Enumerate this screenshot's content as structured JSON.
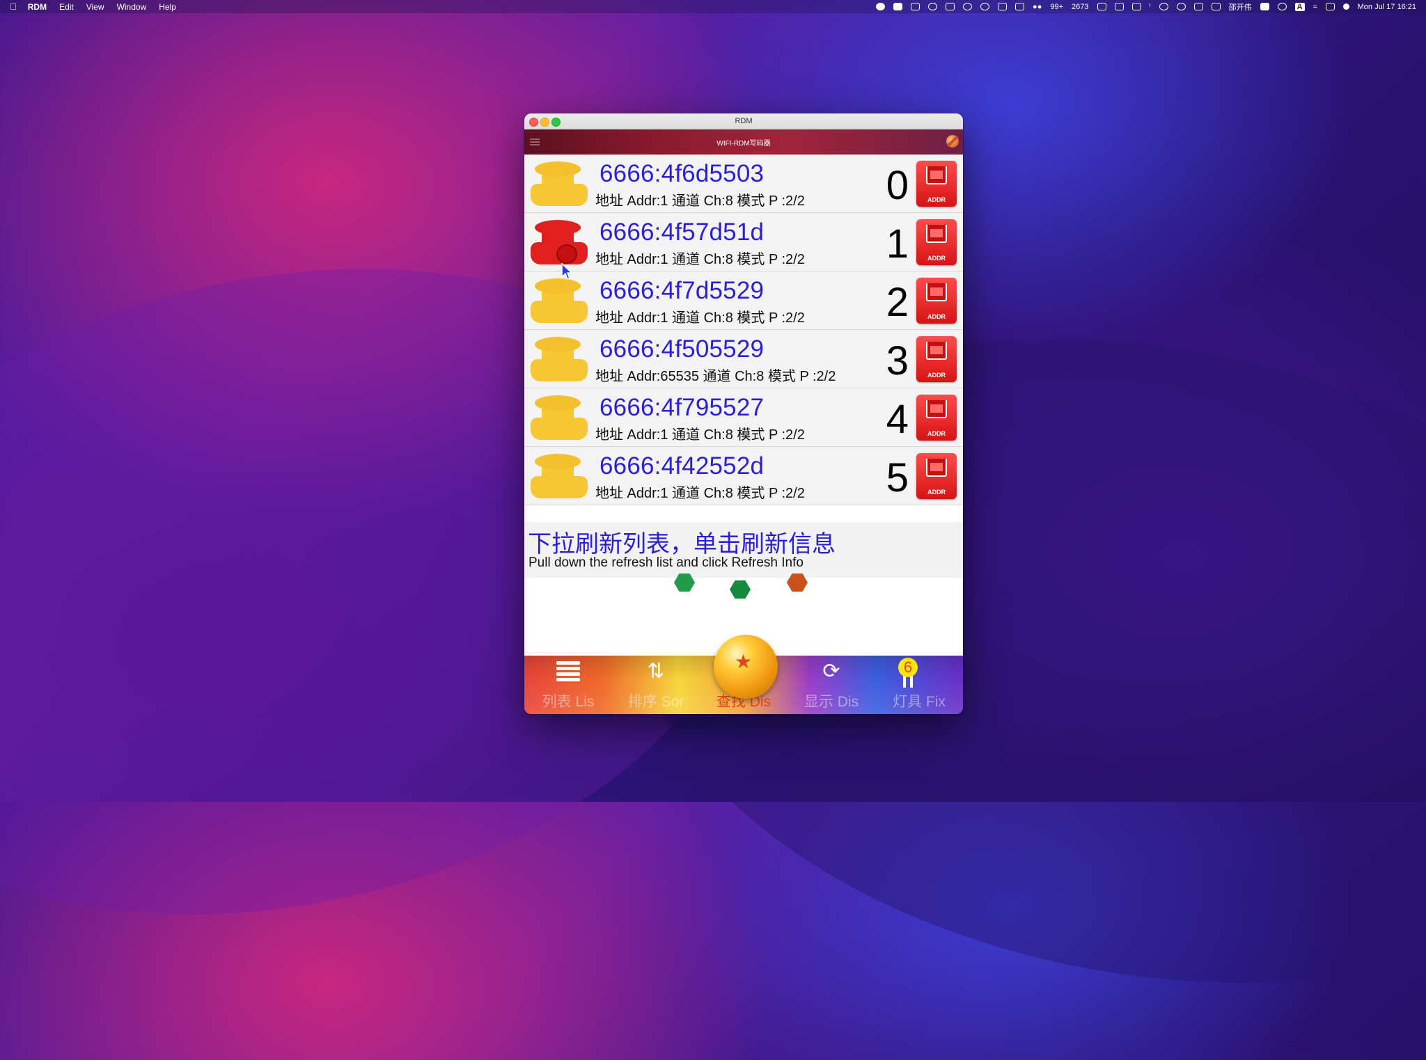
{
  "menubar": {
    "app": "RDM",
    "menus": [
      "Edit",
      "View",
      "Window",
      "Help"
    ],
    "status": {
      "wechat_count": "99+",
      "counter": "2673",
      "user": "邵开伟",
      "input_method": "A",
      "datetime": "Mon Jul 17  16:21"
    }
  },
  "window": {
    "title": "RDM",
    "app_title": "WIFI-RDM写码器"
  },
  "devices": [
    {
      "id": "6666:4f6d5503",
      "info": "地址 Addr:1  通道 Ch:8  模式 P :2/2",
      "index": "0",
      "state": "normal"
    },
    {
      "id": "6666:4f57d51d",
      "info": "地址 Addr:1  通道 Ch:8  模式 P :2/2",
      "index": "1",
      "state": "selected"
    },
    {
      "id": "6666:4f7d5529",
      "info": "地址 Addr:1  通道 Ch:8  模式 P :2/2",
      "index": "2",
      "state": "normal"
    },
    {
      "id": "6666:4f505529",
      "info": "地址 Addr:65535  通道 Ch:8  模式 P :2/2",
      "index": "3",
      "state": "normal"
    },
    {
      "id": "6666:4f795527",
      "info": "地址 Addr:1  通道 Ch:8  模式 P :2/2",
      "index": "4",
      "state": "normal"
    },
    {
      "id": "6666:4f42552d",
      "info": "地址 Addr:1  通道 Ch:8  模式 P :2/2",
      "index": "5",
      "state": "normal"
    }
  ],
  "addr_button_label": "ADDR",
  "hint": {
    "zh": "下拉刷新列表，单击刷新信息",
    "en": "Pull down the refresh list and click Refresh Info"
  },
  "tabs": [
    {
      "label": "列表 Lis",
      "icon": "list-icon"
    },
    {
      "label": "排序 Sor",
      "icon": "sort-icon"
    },
    {
      "label": "查找 Dis",
      "icon": "star-ball-icon",
      "active": true
    },
    {
      "label": "显示 Dis",
      "icon": "refresh-icon"
    },
    {
      "label": "灯具 Fix",
      "icon": "fixture-icon",
      "badge": "6"
    }
  ],
  "colors": {
    "accent_blue": "#2a1fd6",
    "spool_yellow": "#f6c633",
    "spool_red": "#e21f1f",
    "active_tab": "#e2441c"
  }
}
